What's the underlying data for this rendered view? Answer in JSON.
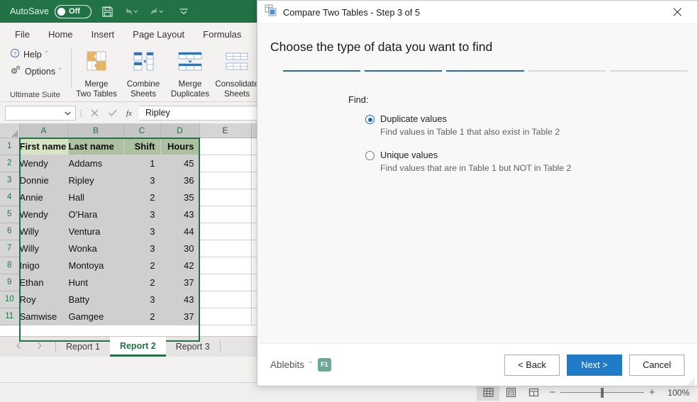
{
  "excel": {
    "quick_access": {
      "autosave_label": "AutoSave",
      "autosave_state": "Off",
      "save_icon": "save-icon",
      "undo_icon": "undo-icon",
      "redo_icon": "redo-icon",
      "customize_icon": "customize-quick-access-icon"
    },
    "ribbon_tabs": [
      "File",
      "Home",
      "Insert",
      "Page Layout",
      "Formulas"
    ],
    "ribbon": {
      "group_caption": "Ultimate Suite",
      "small_commands": [
        {
          "label": "Help",
          "icon": "help-icon",
          "chevron": "ˇ"
        },
        {
          "label": "Options",
          "icon": "gear-icon",
          "chevron": "ˇ"
        }
      ],
      "big_buttons": [
        {
          "line1": "Merge",
          "line2": "Two Tables",
          "icon": "merge-two-tables-icon"
        },
        {
          "line1": "Combine",
          "line2": "Sheets",
          "icon": "combine-sheets-icon"
        },
        {
          "line1": "Merge",
          "line2": "Duplicates",
          "icon": "merge-duplicates-icon"
        },
        {
          "line1": "Consolidate",
          "line2": "Sheets",
          "icon": "consolidate-sheets-icon"
        }
      ]
    },
    "formula_bar": {
      "name_box_value": "",
      "cancel_icon": "cancel-icon",
      "enter_icon": "confirm-icon",
      "function_icon": "insert-function-icon",
      "value": "Ripley"
    },
    "grid": {
      "columns": [
        "A",
        "B",
        "C",
        "D",
        "E"
      ],
      "selected_columns": [
        "A",
        "B",
        "C",
        "D"
      ],
      "rows": [
        {
          "num": "1",
          "cells": [
            "First name",
            "Last name",
            "Shift",
            "Hours"
          ]
        },
        {
          "num": "2",
          "cells": [
            "Wendy",
            "Addams",
            "1",
            "45"
          ]
        },
        {
          "num": "3",
          "cells": [
            "Donnie",
            "Ripley",
            "3",
            "36"
          ]
        },
        {
          "num": "4",
          "cells": [
            "Annie",
            "Hall",
            "2",
            "35"
          ]
        },
        {
          "num": "5",
          "cells": [
            "Wendy",
            "O'Hara",
            "3",
            "43"
          ]
        },
        {
          "num": "6",
          "cells": [
            "Willy",
            "Ventura",
            "3",
            "44"
          ]
        },
        {
          "num": "7",
          "cells": [
            "Willy",
            "Wonka",
            "3",
            "30"
          ]
        },
        {
          "num": "8",
          "cells": [
            "Inigo",
            "Montoya",
            "2",
            "42"
          ]
        },
        {
          "num": "9",
          "cells": [
            "Ethan",
            "Hunt",
            "2",
            "37"
          ]
        },
        {
          "num": "10",
          "cells": [
            "Roy",
            "Batty",
            "3",
            "43"
          ]
        },
        {
          "num": "11",
          "cells": [
            "Samwise",
            "Gamgee",
            "2",
            "37"
          ]
        }
      ]
    },
    "sheet_tabs": {
      "prev_icon": "previous-sheet-icon",
      "next_icon": "next-sheet-icon",
      "tabs": [
        {
          "label": "Report 1",
          "active": false
        },
        {
          "label": "Report 2",
          "active": true
        },
        {
          "label": "Report 3",
          "active": false
        }
      ]
    },
    "status_bar": {
      "views": [
        {
          "icon": "normal-view-icon",
          "active": true
        },
        {
          "icon": "page-layout-view-icon",
          "active": false
        },
        {
          "icon": "page-break-preview-icon",
          "active": false
        }
      ],
      "zoom_out": "−",
      "zoom_in": "+",
      "zoom_value": "100%"
    }
  },
  "dialog": {
    "icon": "compare-tables-icon",
    "title": "Compare Two Tables - Step 3 of 5",
    "close_icon": "close-icon",
    "heading": "Choose the type of data you want to find",
    "steps": [
      {
        "done": true
      },
      {
        "done": true
      },
      {
        "done": true
      },
      {
        "done": false
      },
      {
        "done": false
      }
    ],
    "find_label": "Find:",
    "options": [
      {
        "title": "Duplicate values",
        "description": "Find values in Table 1 that also exist in Table 2",
        "selected": true
      },
      {
        "title": "Unique values",
        "description": "Find values that are in Table 1 but NOT in Table 2",
        "selected": false
      }
    ],
    "footer": {
      "brand": "Ablebits",
      "brand_chevron": "ˇ",
      "help_badge": "F1",
      "back_label": "< Back",
      "next_label": "Next >",
      "cancel_label": "Cancel"
    }
  },
  "colors": {
    "excel_green": "#217346",
    "dialog_accent": "#1f7ac8",
    "step_done": "#2b6aa8",
    "radio_blue": "#0f6cbd",
    "header_fill": "#adc1a0",
    "badge_teal": "#6aa897"
  }
}
